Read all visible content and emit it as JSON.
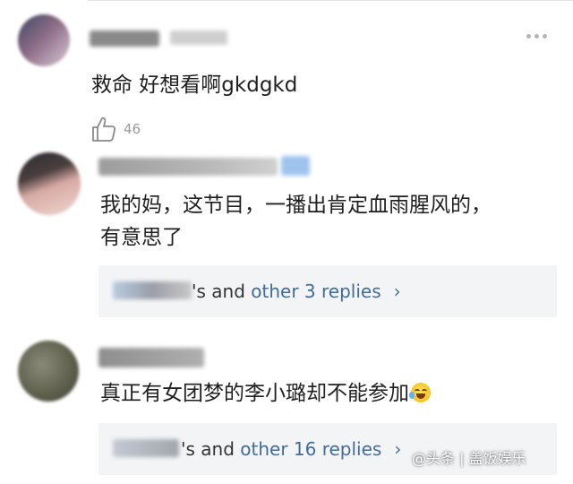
{
  "comments": [
    {
      "text_lines": [
        "救命 好想看啊gkdgkd"
      ],
      "like_count": "46",
      "colors": {
        "avatar": "#6b5566"
      }
    },
    {
      "text_lines": [
        "我的妈，这节目，一播出肯定血雨腥风的，",
        "有意思了"
      ],
      "replies": {
        "prefix": "'s and ",
        "link": "other 3 replies",
        "chevron": "›"
      },
      "colors": {
        "avatar": "#c9a49c"
      }
    },
    {
      "text_lines": [
        "真正有女团梦的李小璐却不能参加"
      ],
      "replies": {
        "prefix": "'s and ",
        "link": "other 16 replies",
        "chevron": "›"
      },
      "colors": {
        "avatar": "#6a6a55"
      }
    }
  ],
  "icons": {
    "more": "more-horizontal-icon",
    "like": "thumbs-up-icon",
    "emoji": "crying-laughing-emoji-icon",
    "chevron": "chevron-right-icon"
  },
  "colors": {
    "link": "#416c9a",
    "reply_bg": "#f3f4f6",
    "text": "#1f1f1f"
  },
  "watermark": "@头条 | 盖饭娱乐"
}
